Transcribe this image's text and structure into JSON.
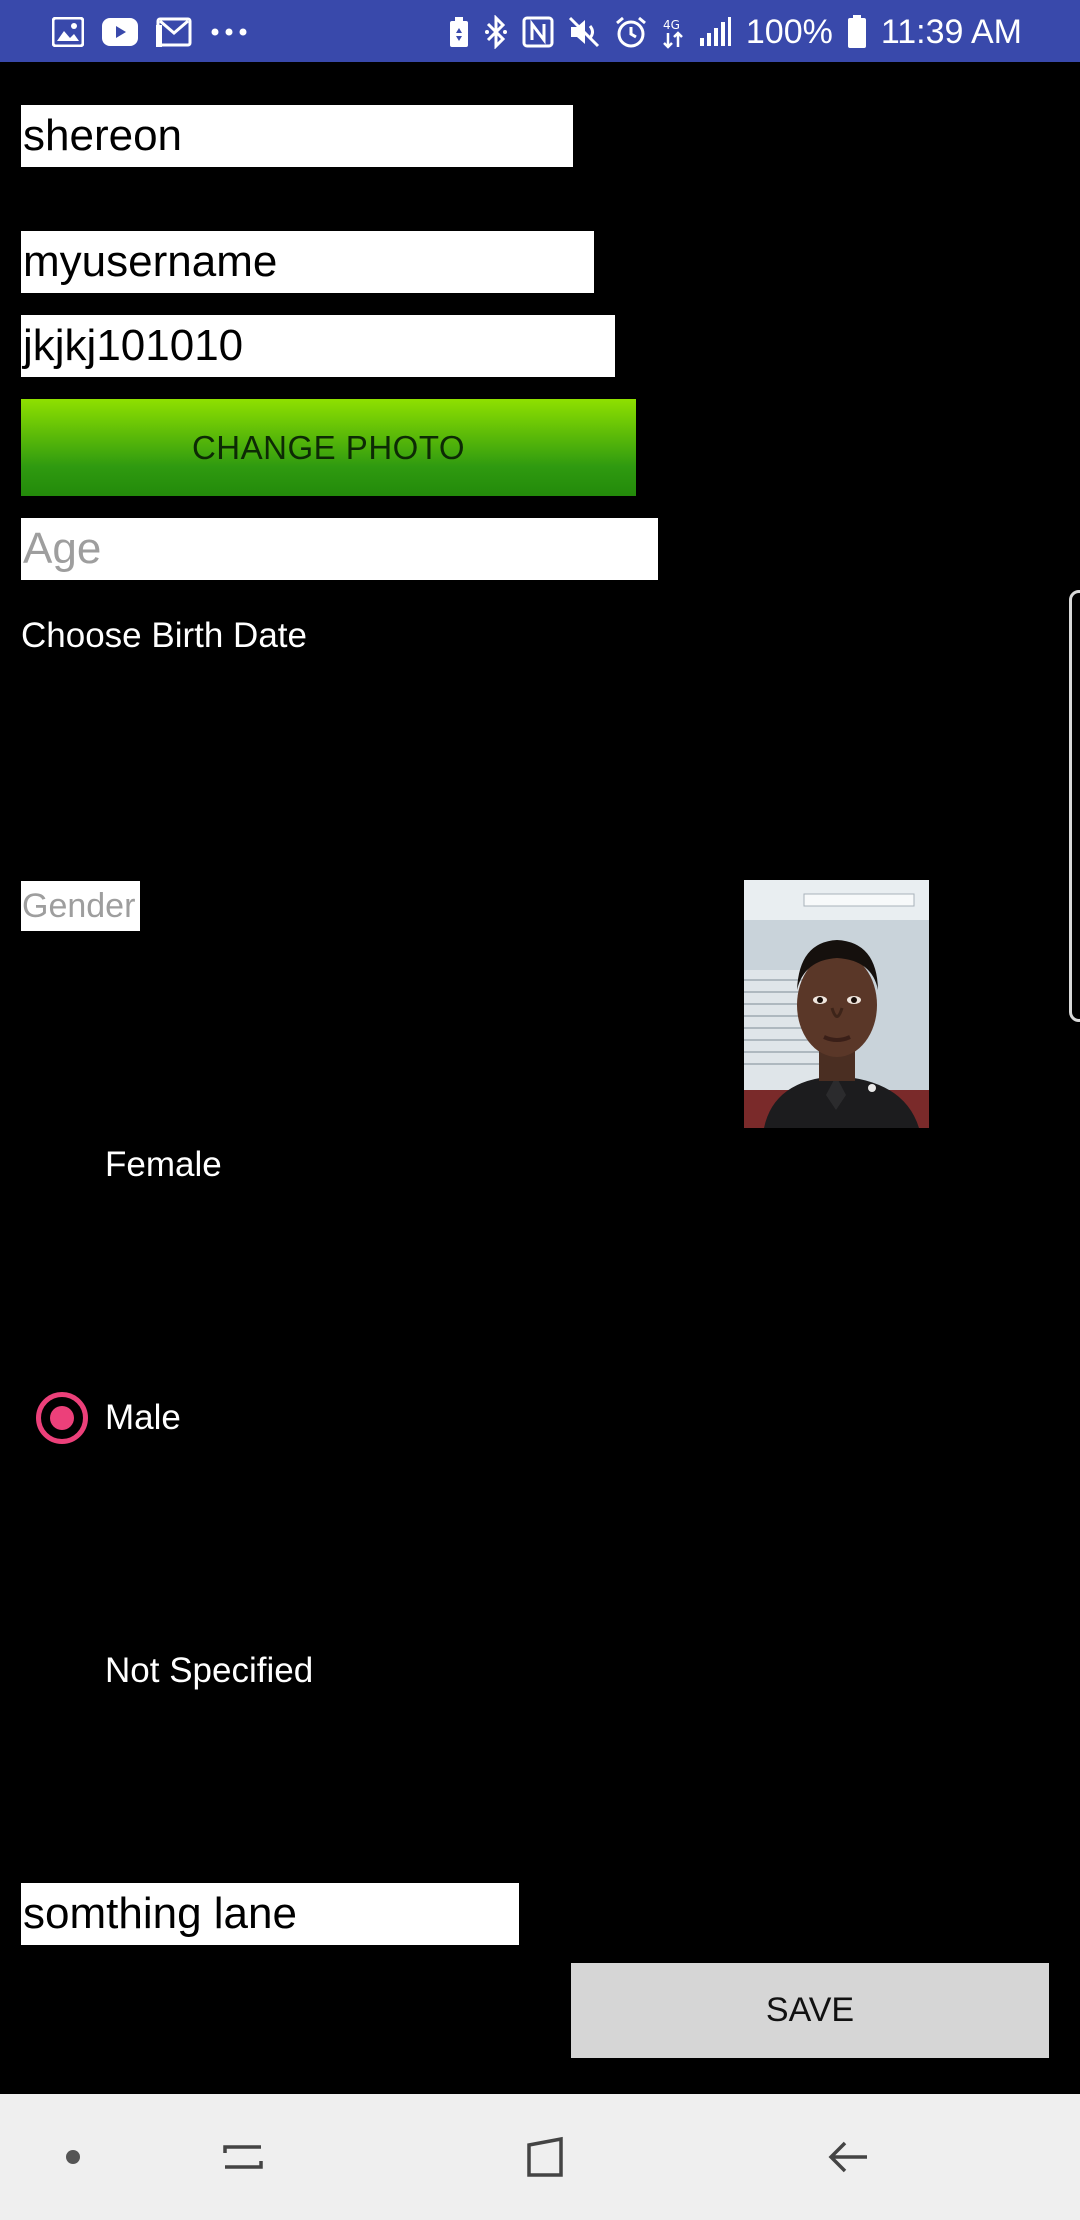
{
  "status_bar": {
    "left_icons": [
      "photos-icon",
      "youtube-icon",
      "gmail-icon",
      "more-dots-icon"
    ],
    "right_icons": [
      "battery-saver-icon",
      "bluetooth-icon",
      "nfc-icon",
      "mute-icon",
      "alarm-icon",
      "data-icon",
      "signal-icon"
    ],
    "battery": "100%",
    "time": "11:39 AM",
    "bar_color": "#3949ab"
  },
  "form": {
    "name_value": "shereon",
    "username_value": "myusername",
    "password_value": "jkjkj101010",
    "change_photo_label": "CHANGE PHOTO",
    "age_placeholder": "Age",
    "birth_date_label": "Choose Birth Date",
    "gender_placeholder": "Gender",
    "gender_options": [
      {
        "label": "Female",
        "selected": false
      },
      {
        "label": "Male",
        "selected": true
      },
      {
        "label": "Not Specified",
        "selected": false
      }
    ],
    "address_value": "somthing lane",
    "save_label": "SAVE"
  },
  "colors": {
    "radio_accent": "#ec407a",
    "button_green_top": "#8fe000",
    "button_green_bottom": "#238a0a"
  },
  "nav_bar": {
    "icons": [
      "home-dot-icon",
      "recents-icon",
      "overview-icon",
      "back-icon"
    ]
  }
}
